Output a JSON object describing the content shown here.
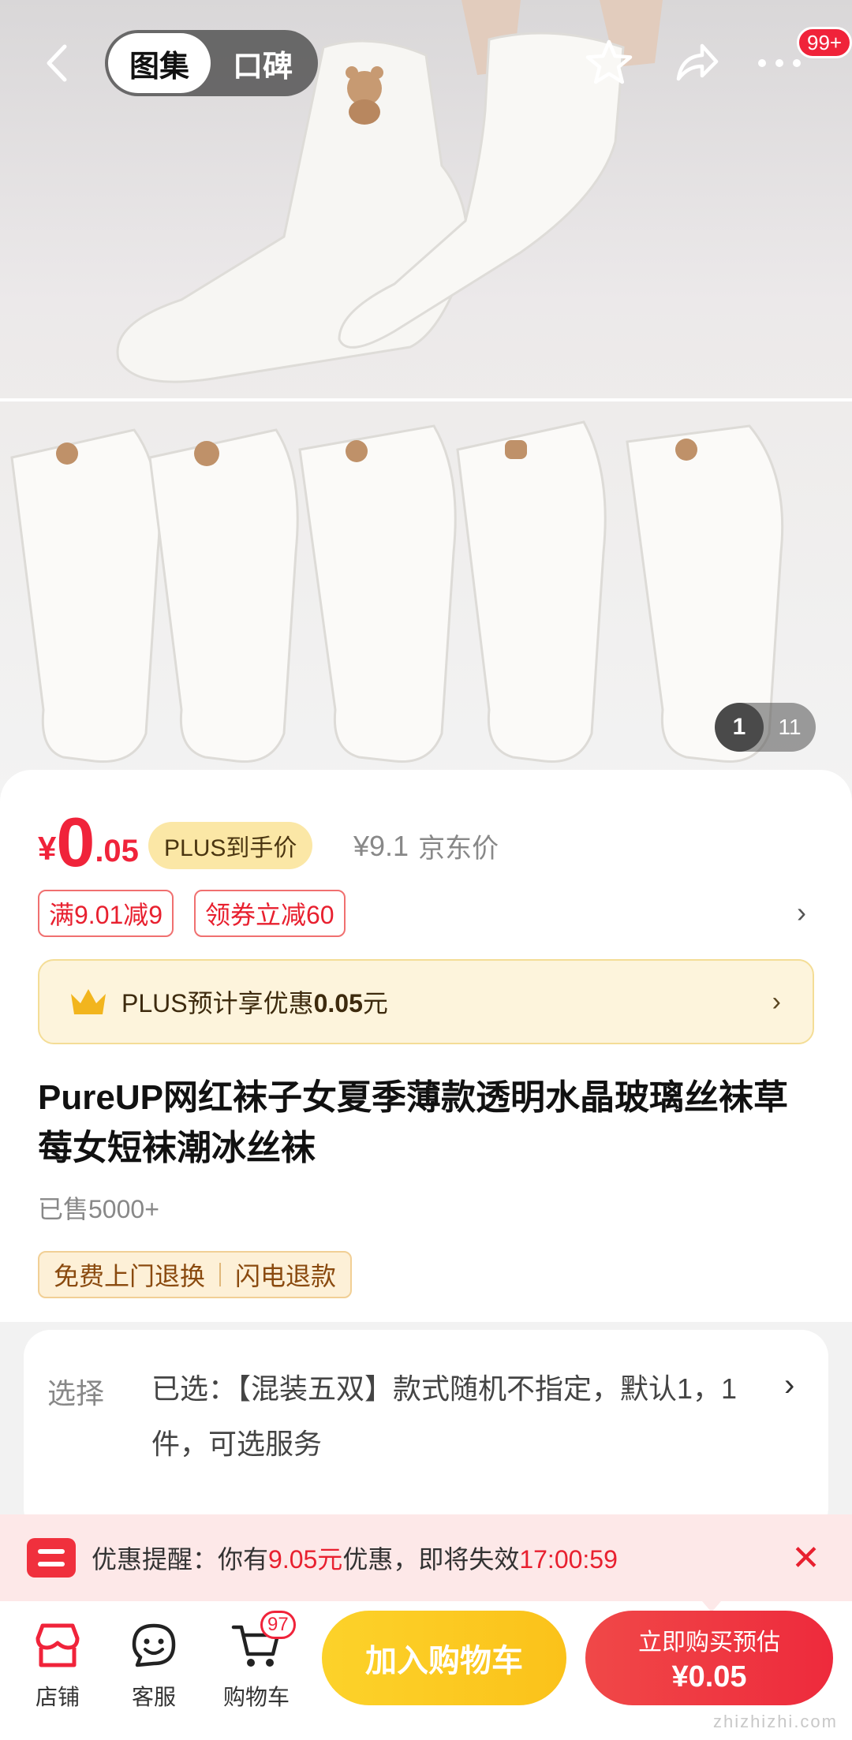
{
  "topbar": {
    "tabs": [
      "图集",
      "口碑"
    ],
    "badge": "99+",
    "icons": [
      "back-arrow-icon",
      "star-icon",
      "share-icon",
      "more-icon"
    ]
  },
  "gallery": {
    "current": "1",
    "total": "11"
  },
  "price": {
    "yen": "¥",
    "int": "0",
    "dec": ".05",
    "plus_tag": "PLUS到手价",
    "jd_price": "¥9.1",
    "jd_label": "京东价"
  },
  "coupons": [
    "满9.01减9",
    "领券立减60"
  ],
  "plus_bar": {
    "prefix": "PLUS预计享优惠",
    "amount": "0.05",
    "suffix": "元"
  },
  "product": {
    "title": "PureUP网红袜子女夏季薄款透明水晶玻璃丝袜草莓女短袜潮冰丝袜",
    "sold": "已售5000+",
    "services": [
      "免费上门退换",
      "闪电退款"
    ]
  },
  "selection": {
    "label": "选择",
    "text": "已选：【混装五双】款式随机不指定，默认1，1件，可选服务"
  },
  "reminder": {
    "prefix": "优惠提醒：你有",
    "amount": "9.05元",
    "middle": "优惠，即将失效",
    "time": "17:00:59"
  },
  "bottom": {
    "shop": "店铺",
    "service": "客服",
    "cart": "购物车",
    "cart_count": "97",
    "add_cart": "加入购物车",
    "buy_line1": "立即购买预估",
    "buy_line2": "¥0.05"
  },
  "watermark": "zhizhizhi.com",
  "colors": {
    "accent_red": "#f0233a",
    "plus_gold": "#fbe7a6",
    "cart_yellow": "#fcd22a"
  }
}
